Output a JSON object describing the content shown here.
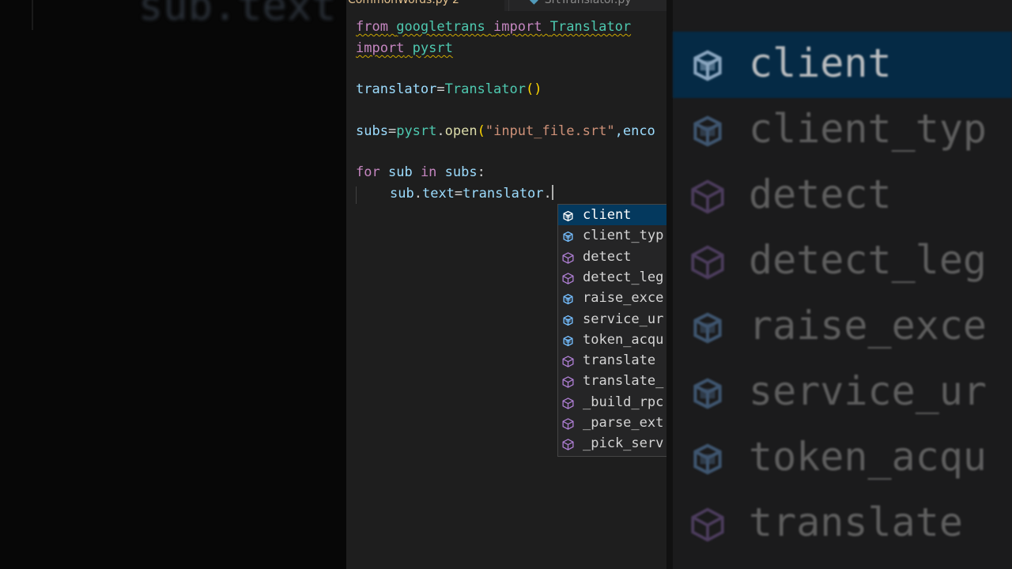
{
  "background_left": {
    "ghost_text": "sub.text"
  },
  "tabs": [
    {
      "label": "CommonWords.py",
      "modified_marker": "2"
    },
    {
      "label": "SrtTranslator.py"
    }
  ],
  "code": {
    "line1": {
      "kw1": "from",
      "module": "googletrans",
      "kw2": "import",
      "cls": "Translator"
    },
    "line2": {
      "kw": "import",
      "module": "pysrt"
    },
    "line4": {
      "var": "translator",
      "eq": "=",
      "cls": "Translator",
      "parens": "()"
    },
    "line6": {
      "var": "subs",
      "eq": "=",
      "obj": "pysrt",
      "dot": ".",
      "fn": "open",
      "open": "(",
      "str": "\"input_file.srt\"",
      "rest": ",enco"
    },
    "line8": {
      "kw1": "for",
      "v1": "sub",
      "kw2": "in",
      "v2": "subs",
      "colon": ":"
    },
    "line9": {
      "obj": "sub",
      "dot": ".",
      "attr": "text",
      "eq": "=",
      "var": "translator",
      "dot2": "."
    }
  },
  "suggestions": [
    {
      "label": "client",
      "kind": "field",
      "selected": true
    },
    {
      "label": "client_typ",
      "kind": "field"
    },
    {
      "label": "detect",
      "kind": "method"
    },
    {
      "label": "detect_leg",
      "kind": "method"
    },
    {
      "label": "raise_exce",
      "kind": "field"
    },
    {
      "label": "service_ur",
      "kind": "field"
    },
    {
      "label": "token_acqu",
      "kind": "field"
    },
    {
      "label": "translate",
      "kind": "method"
    },
    {
      "label": "translate_",
      "kind": "method"
    },
    {
      "label": "_build_rpc",
      "kind": "method"
    },
    {
      "label": "_parse_ext",
      "kind": "method"
    },
    {
      "label": "_pick_serv",
      "kind": "method"
    }
  ],
  "zoomed_suggestions": [
    {
      "label": "client",
      "kind": "field",
      "selected": true
    },
    {
      "label": "client_typ",
      "kind": "field"
    },
    {
      "label": "detect",
      "kind": "method"
    },
    {
      "label": "detect_leg",
      "kind": "method"
    },
    {
      "label": "raise_exce",
      "kind": "field"
    },
    {
      "label": "service_ur",
      "kind": "field"
    },
    {
      "label": "token_acqu",
      "kind": "field"
    },
    {
      "label": "translate",
      "kind": "method"
    }
  ],
  "colors": {
    "keyword": "#c586c0",
    "module": "#4ec9b0",
    "variable": "#9cdcfe",
    "function": "#dcdcaa",
    "string": "#ce9178",
    "field_icon": "#75beff",
    "method_icon": "#b180d7",
    "selection": "#04395e"
  }
}
